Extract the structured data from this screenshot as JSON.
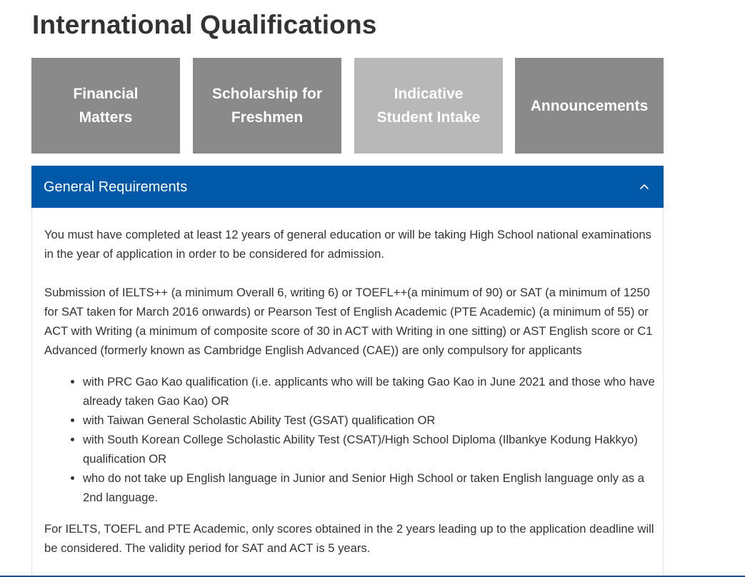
{
  "page": {
    "title": "International Qualifications"
  },
  "tiles": [
    {
      "line1": "Financial",
      "line2": "Matters"
    },
    {
      "line1": "Scholarship for",
      "line2": "Freshmen"
    },
    {
      "line1": "Indicative",
      "line2": "Student Intake"
    },
    {
      "line1": "Announcements",
      "line2": ""
    }
  ],
  "accordion": {
    "title": "General Requirements",
    "toggle_icon": "chevron-up-icon",
    "header_color": "#0058a9",
    "paragraph1": "You must have completed at least 12 years of general education or will be taking High School national examinations in the year of application in order to be considered for admission.",
    "paragraph2": "Submission of IELTS++ (a minimum Overall 6, writing 6) or TOEFL++(a minimum of 90) or SAT (a minimum of 1250 for SAT taken for March 2016 onwards) or Pearson Test of English Academic (PTE Academic) (a minimum of 55) or ACT with Writing (a minimum of composite score of 30 in ACT with Writing in one sitting) or AST English score or C1 Advanced (formerly known as Cambridge English Advanced (CAE)) are only compulsory for applicants",
    "list": [
      "with PRC Gao Kao qualification (i.e. applicants who will be taking Gao Kao in June 2021 and those who have already taken Gao Kao) OR",
      "with Taiwan General Scholastic Ability Test (GSAT) qualification OR",
      "with South Korean College Scholastic Ability Test (CSAT)/High School Diploma (Ilbankye Kodung Hakkyo) qualification OR",
      "who do not take up English language in Junior and Senior High School or taken English language only as a 2nd language."
    ],
    "paragraph3": "For IELTS, TOEFL and PTE Academic, only scores obtained in the 2 years leading up to the application deadline will be considered. The validity period for SAT and ACT is 5 years."
  },
  "colors": {
    "tile": "#8a8a8a",
    "tile_light": "#b8b8b8"
  }
}
